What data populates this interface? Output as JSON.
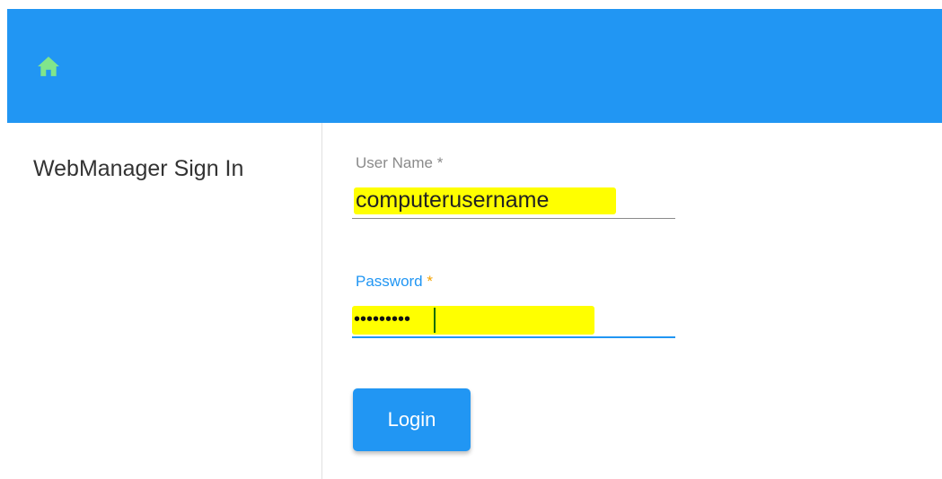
{
  "appbar": {
    "home_icon": "home-icon",
    "home_icon_color": "#81e58b",
    "background": "#2196f3"
  },
  "sidebar": {
    "title": "WebManager Sign In"
  },
  "form": {
    "username": {
      "label": "User Name",
      "required_mark": "*",
      "value": "computerusername"
    },
    "password": {
      "label": "Password",
      "required_mark": "*",
      "masked_value": "•••••••••"
    },
    "login_label": "Login"
  }
}
